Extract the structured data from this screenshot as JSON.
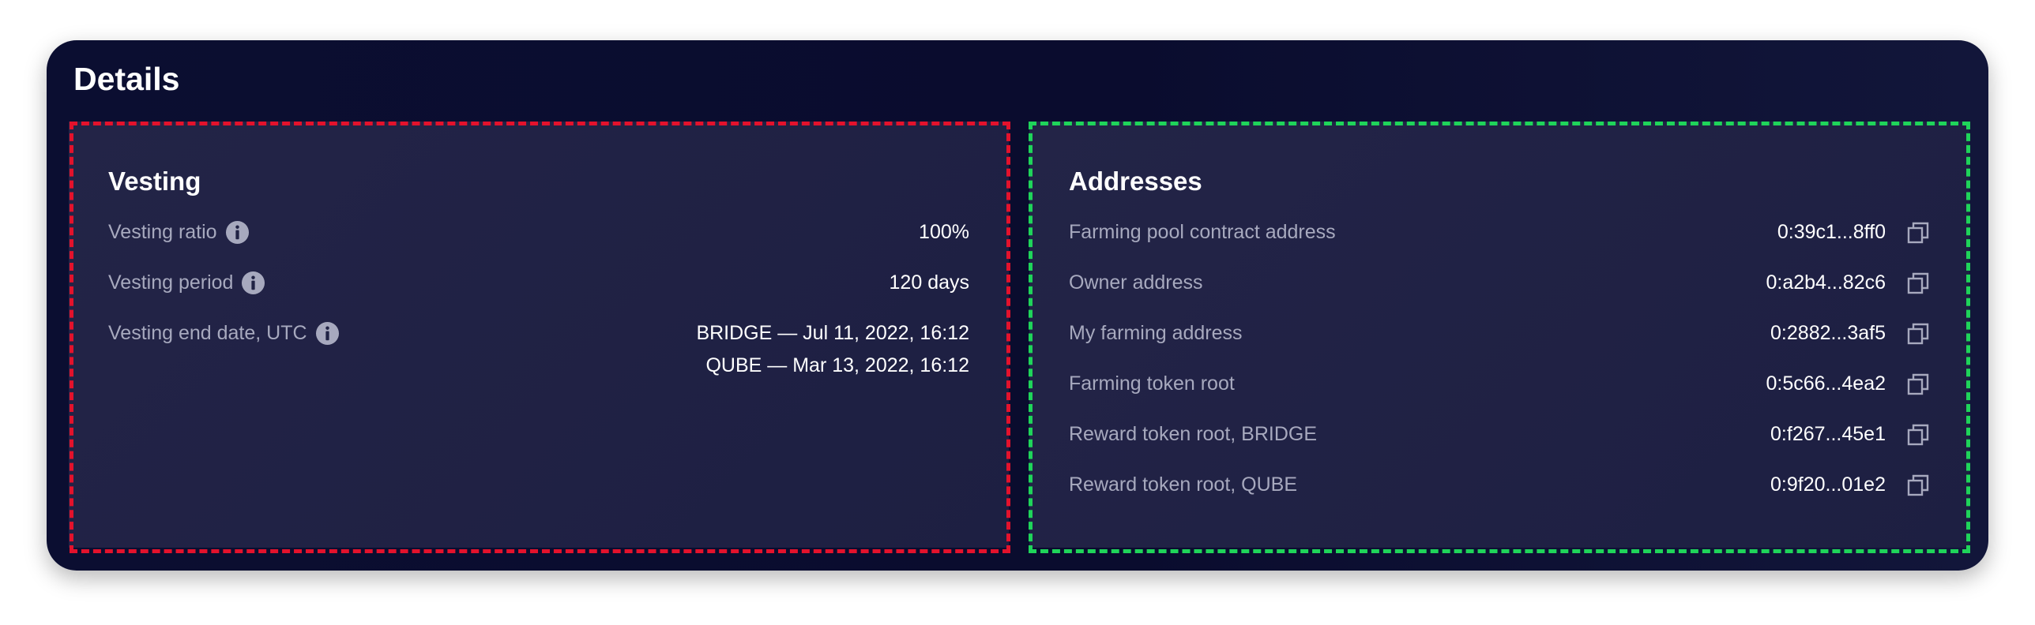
{
  "card": {
    "title": "Details"
  },
  "vesting": {
    "title": "Vesting",
    "rows": [
      {
        "label": "Vesting ratio",
        "icon": "info-icon",
        "value": "100%"
      },
      {
        "label": "Vesting period",
        "icon": "info-icon",
        "value": "120 days"
      },
      {
        "label": "Vesting end date, UTC",
        "icon": "info-icon",
        "values": [
          "BRIDGE — Jul 11, 2022, 16:12",
          "QUBE — Mar 13, 2022, 16:12"
        ]
      }
    ]
  },
  "addresses": {
    "title": "Addresses",
    "rows": [
      {
        "label": "Farming pool contract address",
        "value": "0:39c1...8ff0",
        "icon": "copy-icon"
      },
      {
        "label": "Owner address",
        "value": "0:a2b4...82c6",
        "icon": "copy-icon"
      },
      {
        "label": "My farming address",
        "value": "0:2882...3af5",
        "icon": "copy-icon"
      },
      {
        "label": "Farming token root",
        "value": "0:5c66...4ea2",
        "icon": "copy-icon"
      },
      {
        "label": "Reward token root, BRIDGE",
        "value": "0:f267...45e1",
        "icon": "copy-icon"
      },
      {
        "label": "Reward token root, QUBE",
        "value": "0:9f20...01e2",
        "icon": "copy-icon"
      }
    ]
  },
  "colors": {
    "card_bg": "#0b0e31",
    "panel_bg": "#212345",
    "label_text": "#a7a9be",
    "value_text": "#ffffff",
    "annotation_left": "#e3122c",
    "annotation_right": "#1fd45a"
  }
}
